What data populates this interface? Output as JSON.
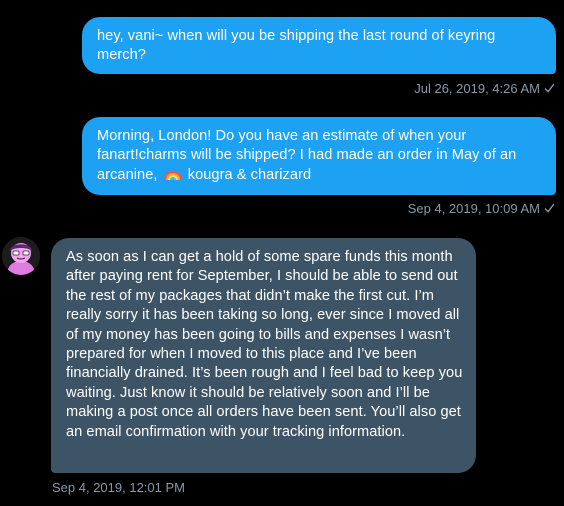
{
  "messages": [
    {
      "direction": "sent",
      "text": "hey, vani~ when will you be shipping the last round of keyring merch?",
      "timestamp": "Jul 26, 2019, 4:26 AM",
      "status_icon": "sent-check-icon"
    },
    {
      "direction": "sent",
      "text_before_emoji": "Morning, London! Do you have an estimate of when your fanart!charms will be shipped? I had made an order in May of an arcanine,",
      "emoji": "rainbow-emoji",
      "text_after_emoji": "kougra & charizard",
      "timestamp": "Sep 4, 2019, 10:09 AM",
      "status_icon": "sent-check-icon"
    },
    {
      "direction": "received",
      "text": "As soon as I can get a hold of some spare funds this month after paying rent for September, I should be able to send out the rest of my packages that didn’t make the first cut. I’m really sorry it has been taking so long, ever since I moved all of my money has been going to bills and expenses I wasn’t prepared for when I moved to this place and I’ve been financially drained. It’s been rough and I feel bad to keep you waiting. Just know it should be relatively soon and I’ll be making a post once all orders have been sent. You’ll also get an email confirmation with your tracking information.",
      "timestamp": "Sep 4, 2019, 12:01 PM"
    }
  ],
  "colors": {
    "background": "#000000",
    "sent_bubble": "#1da1f2",
    "received_bubble": "#3d5466",
    "meta_text": "#8899a6",
    "message_text": "#ffffff"
  }
}
